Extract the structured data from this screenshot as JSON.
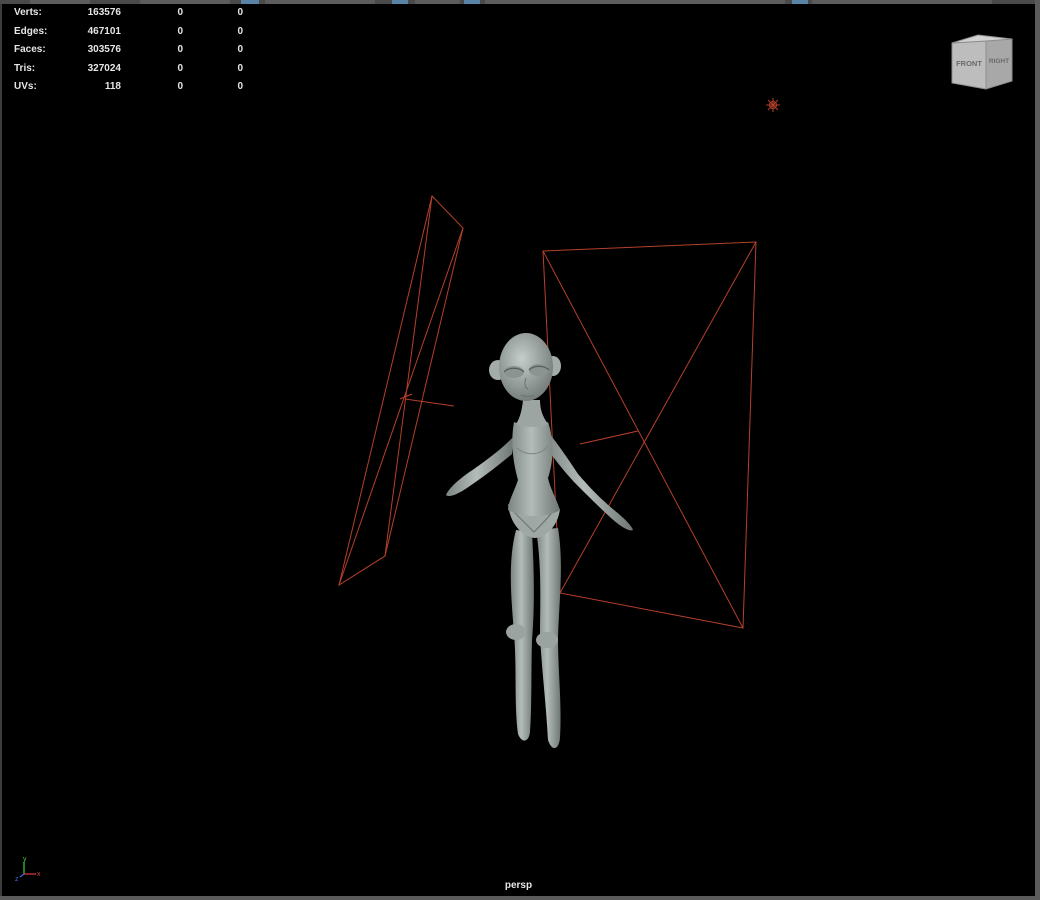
{
  "hud": {
    "rows": [
      {
        "label": "Verts:",
        "v1": "163576",
        "v2": "0",
        "v3": "0"
      },
      {
        "label": "Edges:",
        "v1": "467101",
        "v2": "0",
        "v3": "0"
      },
      {
        "label": "Faces:",
        "v1": "303576",
        "v2": "0",
        "v3": "0"
      },
      {
        "label": "Tris:",
        "v1": "327024",
        "v2": "0",
        "v3": "0"
      },
      {
        "label": "UVs:",
        "v1": "118",
        "v2": "0",
        "v3": "0"
      }
    ]
  },
  "viewcube": {
    "front": "FRONT",
    "right": "RIGHT"
  },
  "camera_name": "persp",
  "axis": {
    "y": "y",
    "x": "x",
    "z": "z"
  },
  "colors": {
    "background": "#000000",
    "light_gizmo": "#b5402a",
    "model": "#a9b1ae",
    "axis_x": "#e03a3a",
    "axis_y": "#3ad13a",
    "axis_z": "#3a6ce0"
  },
  "icons": [
    "point-light-icon",
    "area-light-icon",
    "viewcube-icon",
    "axis-gizmo-icon"
  ]
}
